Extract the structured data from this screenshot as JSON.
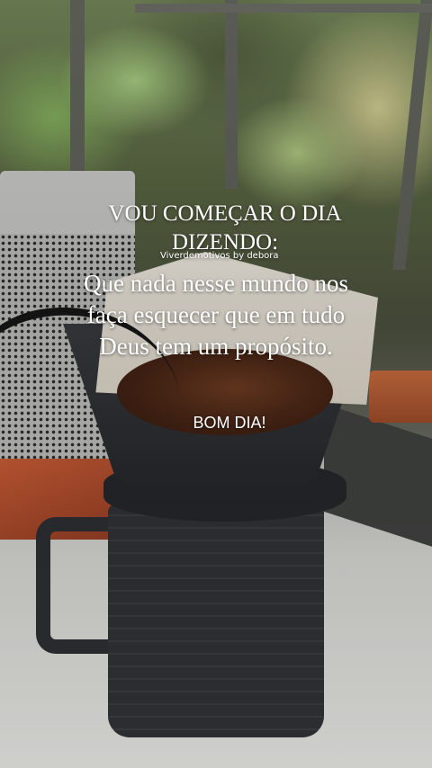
{
  "post": {
    "heading": "VOU COMEÇAR O DIA DIZENDO:",
    "watermark": "Viverdemotivos by debora",
    "message": "Que nada nesse mundo nos faça esquecer que em tudo Deus tem um propósito.",
    "greeting": "BOM DIA!"
  },
  "colors": {
    "text": "#ffffff",
    "jug": "#2e3034",
    "coffee": "#4b2716",
    "foliage": "#7fa85a"
  }
}
